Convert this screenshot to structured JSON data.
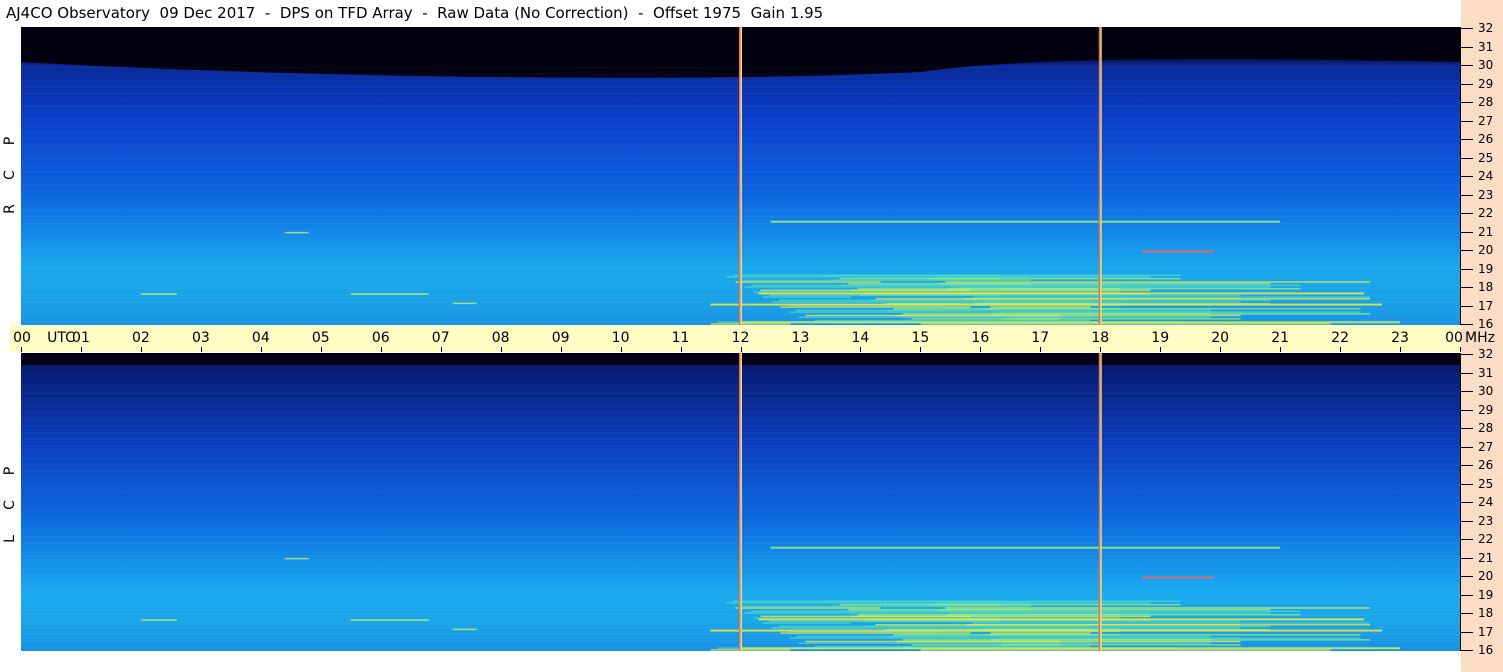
{
  "header": {
    "title": "AJ4CO Observatory  09 Dec 2017  -  DPS on TFD Array  -  Raw Data (No Correction)  -  Offset 1975  Gain 1.95"
  },
  "panels": {
    "top_label": [
      "R",
      "C",
      "P"
    ],
    "bottom_label": [
      "L",
      "C",
      "P"
    ]
  },
  "colors": {
    "background": "#ffffff",
    "time_axis_bg": "#fffcc4",
    "freq_axis_bg": "#fbdcc4",
    "marker_line": "#e86a6a"
  },
  "chart_data": [
    {
      "type": "heatmap",
      "polarization": "RCP",
      "x_axis": {
        "unit": "UTC",
        "ticks": [
          "00",
          "01",
          "02",
          "03",
          "04",
          "05",
          "06",
          "07",
          "08",
          "09",
          "10",
          "11",
          "12",
          "13",
          "14",
          "15",
          "16",
          "17",
          "18",
          "19",
          "20",
          "21",
          "22",
          "23",
          "00"
        ],
        "range": [
          0,
          24
        ]
      },
      "y_axis": {
        "unit": "MHz",
        "ticks": [
          16,
          17,
          18,
          19,
          20,
          21,
          22,
          23,
          24,
          25,
          26,
          27,
          28,
          29,
          30,
          31,
          32
        ],
        "range": [
          16,
          32
        ]
      },
      "marker_times": [
        12.0,
        18.0
      ]
    },
    {
      "type": "heatmap",
      "polarization": "LCP",
      "x_axis": {
        "unit": "UTC",
        "ticks": [
          "00",
          "01",
          "02",
          "03",
          "04",
          "05",
          "06",
          "07",
          "08",
          "09",
          "10",
          "11",
          "12",
          "13",
          "14",
          "15",
          "16",
          "17",
          "18",
          "19",
          "20",
          "21",
          "22",
          "23",
          "00"
        ],
        "range": [
          0,
          24
        ]
      },
      "y_axis": {
        "unit": "MHz",
        "ticks": [
          16,
          17,
          18,
          19,
          20,
          21,
          22,
          23,
          24,
          25,
          26,
          27,
          28,
          29,
          30,
          31,
          32
        ],
        "range": [
          16,
          32
        ]
      },
      "marker_times": [
        12.0,
        18.0
      ]
    }
  ],
  "time_axis": {
    "labels": [
      "00",
      "UTC",
      "01",
      "02",
      "03",
      "04",
      "05",
      "06",
      "07",
      "08",
      "09",
      "10",
      "11",
      "12",
      "13",
      "14",
      "15",
      "16",
      "17",
      "18",
      "19",
      "20",
      "21",
      "22",
      "23",
      "00",
      "MHz"
    ]
  }
}
